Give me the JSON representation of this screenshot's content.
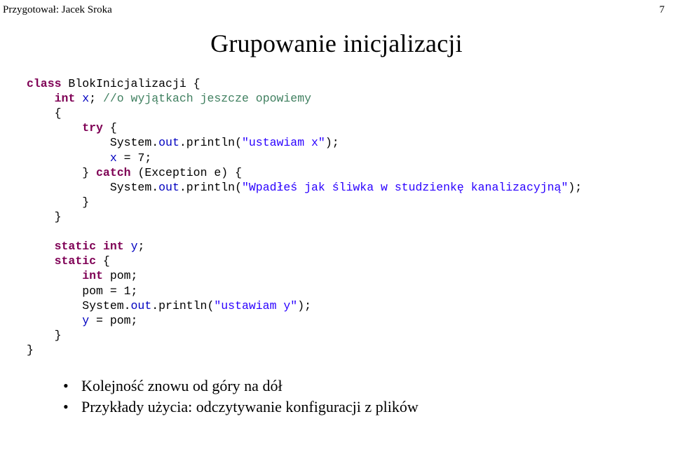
{
  "header": {
    "author_label": "Przygotował: Jacek Sroka",
    "page_number": "7"
  },
  "title": "Grupowanie inicjalizacji",
  "code": {
    "l1_kw_class": "class",
    "l1_rest": " BlokInicjalizacji {",
    "l2_a": "    ",
    "l2_kw_int": "int",
    "l2_b": " ",
    "l2_fld_x": "x",
    "l2_c": "; ",
    "l2_com": "//o wyjątkach jeszcze opowiemy",
    "l3": "    {",
    "l4_a": "        ",
    "l4_kw_try": "try",
    "l4_b": " {",
    "l5_a": "            System.",
    "l5_fld_out": "out",
    "l5_b": ".println(",
    "l5_str": "\"ustawiam x\"",
    "l5_c": ");",
    "l6_a": "            ",
    "l6_fld_x": "x",
    "l6_b": " = 7;",
    "l7_a": "        } ",
    "l7_kw_catch": "catch",
    "l7_b": " (Exception e) {",
    "l8_a": "            System.",
    "l8_fld_out": "out",
    "l8_b": ".println(",
    "l8_str": "\"Wpadłeś jak śliwka w studzienkę kanalizacyjną\"",
    "l8_c": ");",
    "l9": "        }",
    "l10": "    }",
    "blank1": "",
    "l11_a": "    ",
    "l11_kw_static": "static",
    "l11_b": " ",
    "l11_kw_int": "int",
    "l11_c": " ",
    "l11_fld_y": "y",
    "l11_d": ";",
    "l12_a": "    ",
    "l12_kw_static": "static",
    "l12_b": " {",
    "l13_a": "        ",
    "l13_kw_int": "int",
    "l13_b": " pom;",
    "l14": "        pom = 1;",
    "l15_a": "        System.",
    "l15_fld_out": "out",
    "l15_b": ".println(",
    "l15_str": "\"ustawiam y\"",
    "l15_c": ");",
    "l16_a": "        ",
    "l16_fld_y": "y",
    "l16_b": " = pom;",
    "l17": "    }",
    "l18": "}"
  },
  "bullets": {
    "b1": "Kolejność znowu od góry na dół",
    "b2": "Przykłady użycia: odczytywanie konfiguracji z plików"
  }
}
